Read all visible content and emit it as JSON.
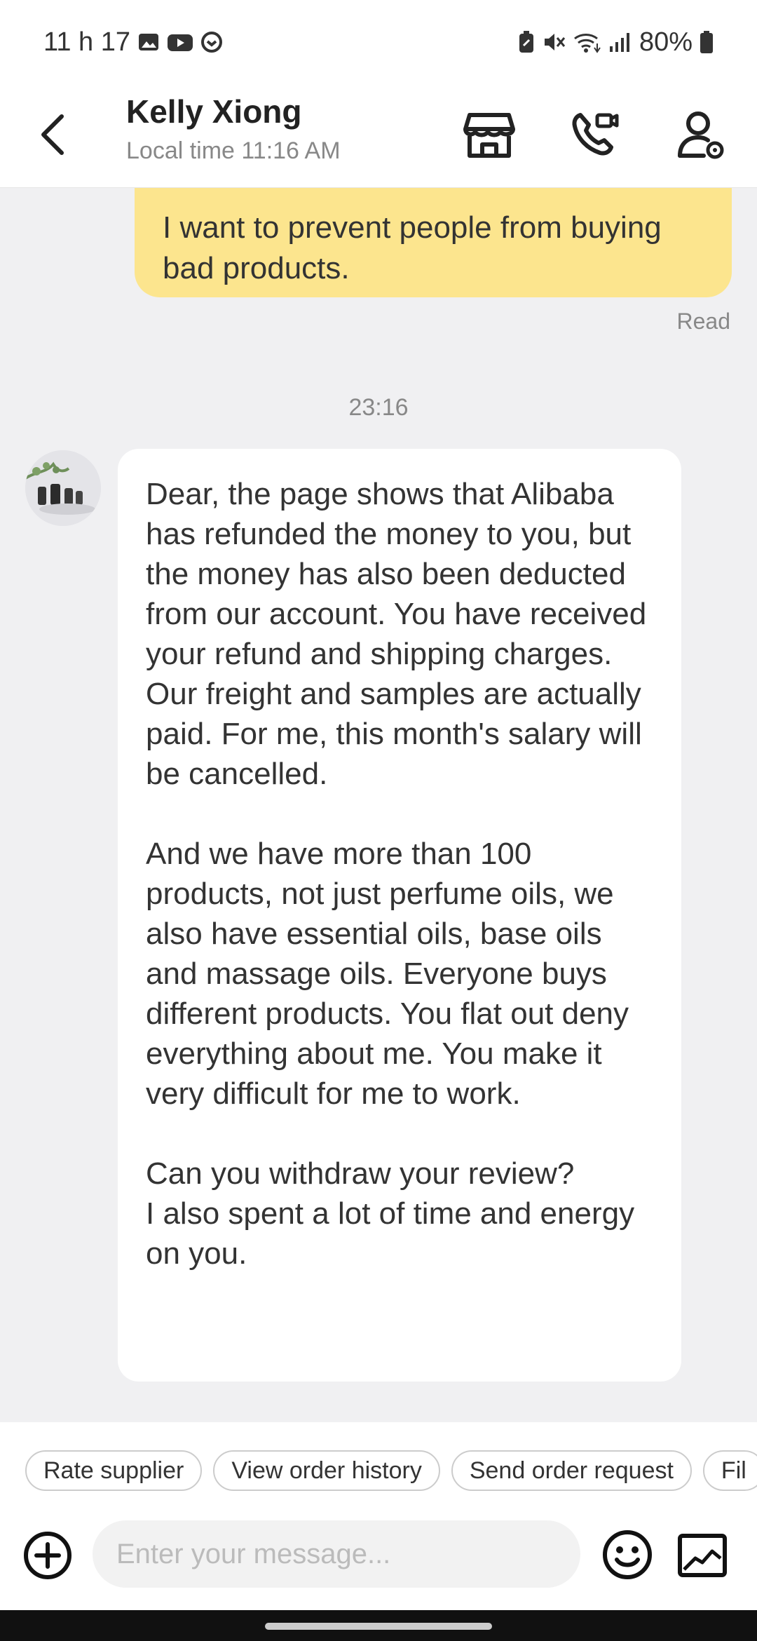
{
  "status_bar": {
    "time": "11 h 17",
    "battery": "80%",
    "icons": [
      "gallery-icon",
      "youtube-icon",
      "shield-icon",
      "battery-saver-icon",
      "mute-icon",
      "wifi-icon",
      "signal-icon",
      "battery-icon"
    ]
  },
  "header": {
    "contact_name": "Kelly Xiong",
    "local_time": "Local time 11:16 AM",
    "icons": [
      "back-arrow-icon",
      "store-icon",
      "video-call-icon",
      "profile-settings-icon"
    ]
  },
  "chat": {
    "outgoing_message": "I want to prevent people from buying bad products.",
    "read_status": "Read",
    "timestamp": "23:16",
    "incoming_message": "Dear, the page shows that Alibaba has refunded the money to you, but the money has also been deducted from our account. You have received your refund and shipping charges. Our freight and samples are actually paid. For me, this month's salary will be cancelled.\n\nAnd we have more than 100 products, not just perfume oils, we also have essential oils, base oils and massage oils. Everyone buys different products. You flat out deny everything about me. You make it very difficult for me to work.\n\nCan you withdraw your review?\nI also spent a lot of time and energy on you."
  },
  "quick_actions": [
    "Rate supplier",
    "View order history",
    "Send order request",
    "Fil"
  ],
  "composer": {
    "placeholder": "Enter your message...",
    "value": ""
  },
  "colors": {
    "outgoing_bubble": "#fce58e",
    "chat_background": "#f0f0f2",
    "incoming_bubble": "#ffffff"
  }
}
